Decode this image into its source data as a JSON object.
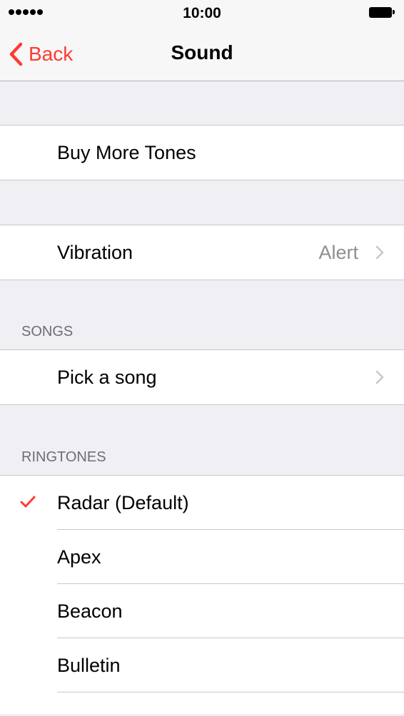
{
  "status_bar": {
    "time": "10:00"
  },
  "nav": {
    "back_label": "Back",
    "title": "Sound"
  },
  "store": {
    "label": "Buy More Tones"
  },
  "vibration": {
    "label": "Vibration",
    "value": "Alert"
  },
  "songs": {
    "header": "SONGS",
    "pick_label": "Pick a song"
  },
  "ringtones": {
    "header": "RINGTONES",
    "items": [
      {
        "label": "Radar (Default)",
        "selected": true
      },
      {
        "label": "Apex",
        "selected": false
      },
      {
        "label": "Beacon",
        "selected": false
      },
      {
        "label": "Bulletin",
        "selected": false
      }
    ]
  },
  "colors": {
    "accent": "#ff3b30",
    "background": "#efeff4",
    "secondary_text": "#8e8e93"
  },
  "icons": {
    "back": "chevron-left-icon",
    "disclosure": "chevron-right-icon",
    "selected": "checkmark-icon",
    "battery": "battery-icon",
    "signal": "signal-strength-icon"
  }
}
